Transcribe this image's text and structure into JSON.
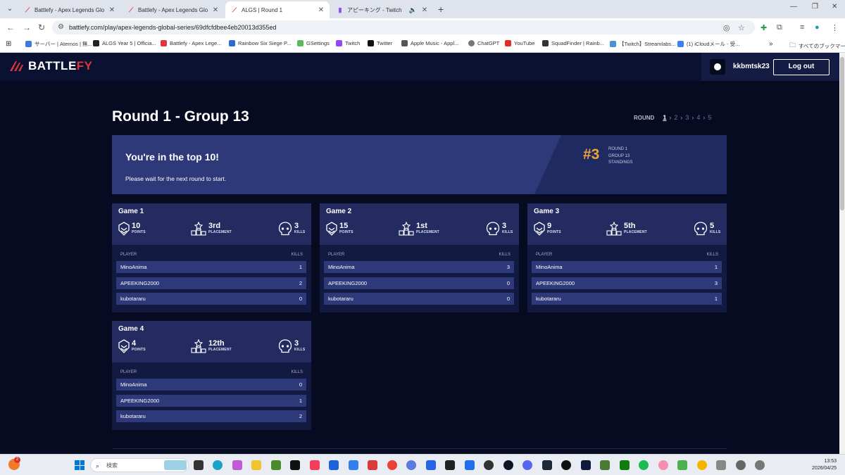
{
  "browser": {
    "tabs": [
      {
        "title": "Battlefy - Apex Legends Global",
        "active": false
      },
      {
        "title": "Battlefy - Apex Legends Global",
        "active": false
      },
      {
        "title": "ALGS | Round 1",
        "active": true
      },
      {
        "title": "アピーキング - Twitch",
        "active": false
      }
    ],
    "url": "battlefy.com/play/apex-legends-global-series/69dfcfdbee4eb20013d355ed",
    "bookmarks": [
      "サーバー | Aternos | 無...",
      "ALGS Year 5 | Officia...",
      "Battlefy - Apex Lege...",
      "Rainbow Six Siege P...",
      "GSettings",
      "Twitch",
      "Twitter",
      "Apple Music - Appl...",
      "ChatGPT",
      "YouTube",
      "SquadFinder | Rainb...",
      "【Twitch】Streamlabs...",
      "(1) iCloudメール - 受...",
      "すべてのブックマーク"
    ]
  },
  "header": {
    "logo_a": "BATTLE",
    "logo_b": "FY",
    "username": "kkbmtsk23",
    "logout": "Log out"
  },
  "page": {
    "title": "Round 1 - Group 13",
    "round_label": "ROUND",
    "rounds": [
      "1",
      "2",
      "3",
      "4",
      "5"
    ]
  },
  "banner": {
    "title": "You're in the top 10!",
    "subtitle": "Please wait for the next round to start.",
    "rank": "#3",
    "rank_line1": "ROUND 1",
    "rank_line2": "GROUP 13",
    "rank_line3": "STANDINGS"
  },
  "labels": {
    "points": "POINTS",
    "placement": "PLACEMENT",
    "kills": "KILLS",
    "player": "PLAYER"
  },
  "games": [
    {
      "name": "Game 1",
      "points": "10",
      "placement": "3rd",
      "kills": "3",
      "players": [
        {
          "name": "MinoAnima",
          "kills": "1"
        },
        {
          "name": "APEEKING2000",
          "kills": "2"
        },
        {
          "name": "kubotararu",
          "kills": "0"
        }
      ]
    },
    {
      "name": "Game 2",
      "points": "15",
      "placement": "1st",
      "kills": "3",
      "players": [
        {
          "name": "MinoAnima",
          "kills": "3"
        },
        {
          "name": "APEEKING2000",
          "kills": "0"
        },
        {
          "name": "kubotararu",
          "kills": "0"
        }
      ]
    },
    {
      "name": "Game 3",
      "points": "9",
      "placement": "5th",
      "kills": "5",
      "players": [
        {
          "name": "MinoAnima",
          "kills": "1"
        },
        {
          "name": "APEEKING2000",
          "kills": "3"
        },
        {
          "name": "kubotararu",
          "kills": "1"
        }
      ]
    },
    {
      "name": "Game 4",
      "points": "4",
      "placement": "12th",
      "kills": "3",
      "players": [
        {
          "name": "MinoAnima",
          "kills": "0"
        },
        {
          "name": "APEEKING2000",
          "kills": "1"
        },
        {
          "name": "kubotararu",
          "kills": "2"
        }
      ]
    }
  ],
  "taskbar": {
    "search": "検索",
    "notification_badge": "2",
    "time": "13:53",
    "date": "2026/04/25"
  }
}
